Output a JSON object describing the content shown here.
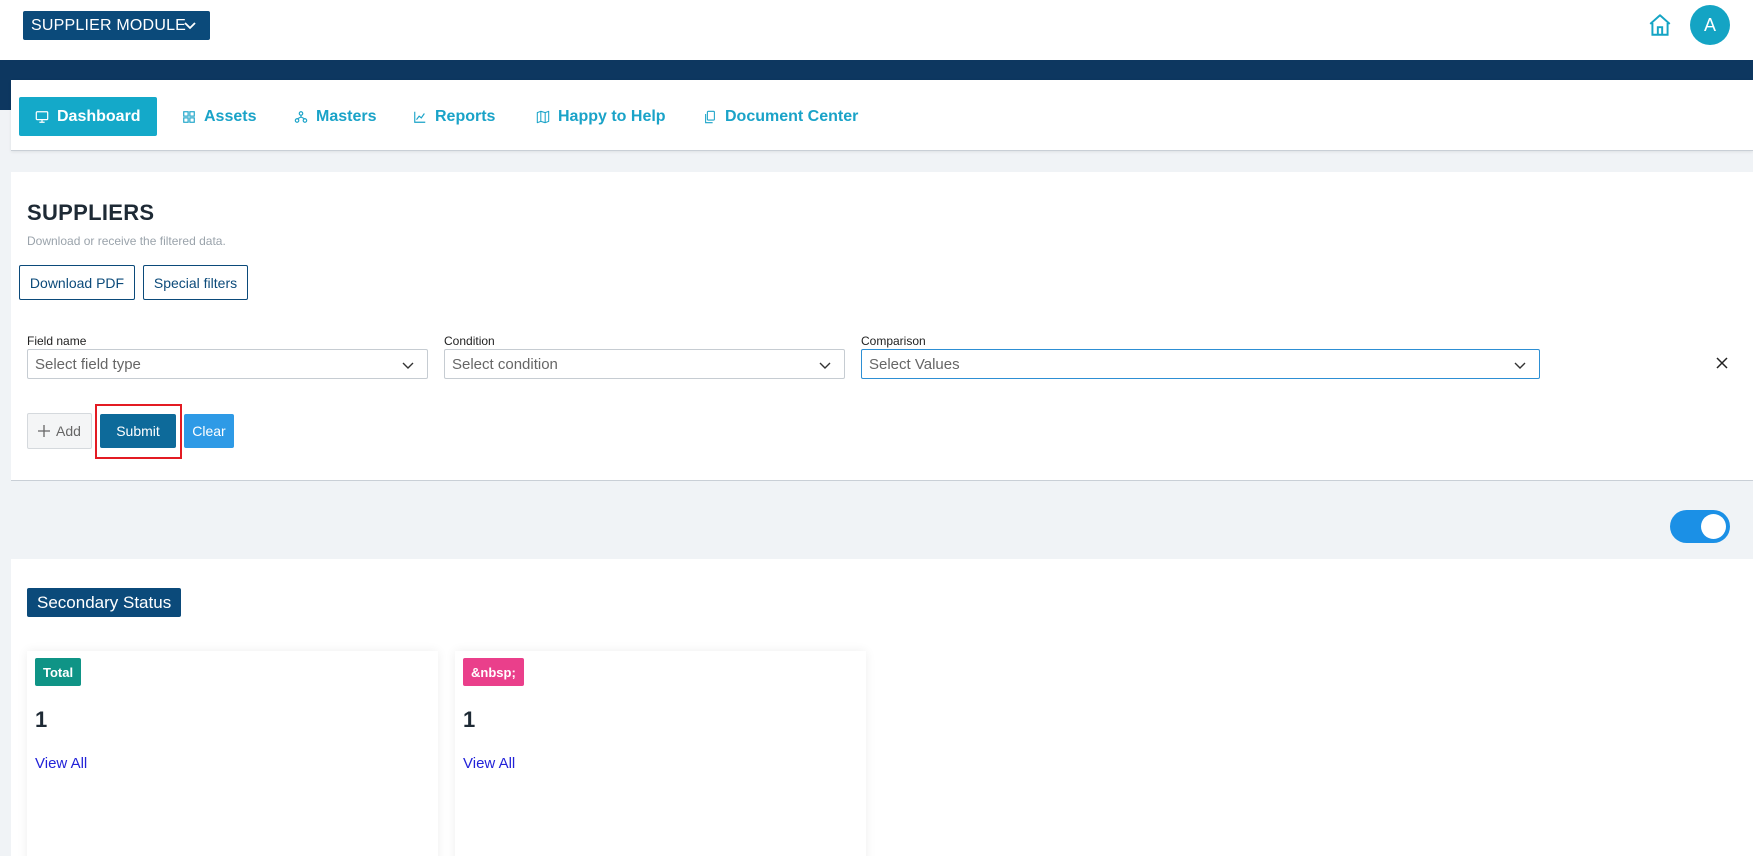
{
  "header": {
    "module_label": "SUPPLIER MODULE",
    "avatar_initial": "A",
    "colors": {
      "brand": "#0b4a7a",
      "accent": "#14a9c9",
      "band": "#0d3760"
    }
  },
  "nav": {
    "items": [
      {
        "label": "Dashboard",
        "icon": "monitor-icon",
        "active": true
      },
      {
        "label": "Assets",
        "icon": "grid-icon"
      },
      {
        "label": "Masters",
        "icon": "sitemap-icon"
      },
      {
        "label": "Reports",
        "icon": "chart-line-icon"
      },
      {
        "label": "Happy to Help",
        "icon": "map-icon"
      },
      {
        "label": "Document Center",
        "icon": "documents-icon"
      }
    ]
  },
  "filters": {
    "title": "SUPPLIERS",
    "subtitle": "Download or receive the filtered data.",
    "download_pdf_label": "Download PDF",
    "special_filters_label": "Special filters",
    "field_name": {
      "label": "Field name",
      "placeholder": "Select field type"
    },
    "condition": {
      "label": "Condition",
      "placeholder": "Select condition"
    },
    "comparison": {
      "label": "Comparison",
      "placeholder": "Select Values"
    },
    "add_label": "Add",
    "submit_label": "Submit",
    "clear_label": "Clear"
  },
  "toggle": {
    "on": true
  },
  "status": {
    "section_label": "Secondary Status",
    "cards": [
      {
        "tag": "Total",
        "tag_color": "#0f9486",
        "value": "1",
        "link": "View All"
      },
      {
        "tag": "&nbsp;",
        "tag_color": "#ea3f8b",
        "value": "1",
        "link": "View All"
      }
    ]
  }
}
